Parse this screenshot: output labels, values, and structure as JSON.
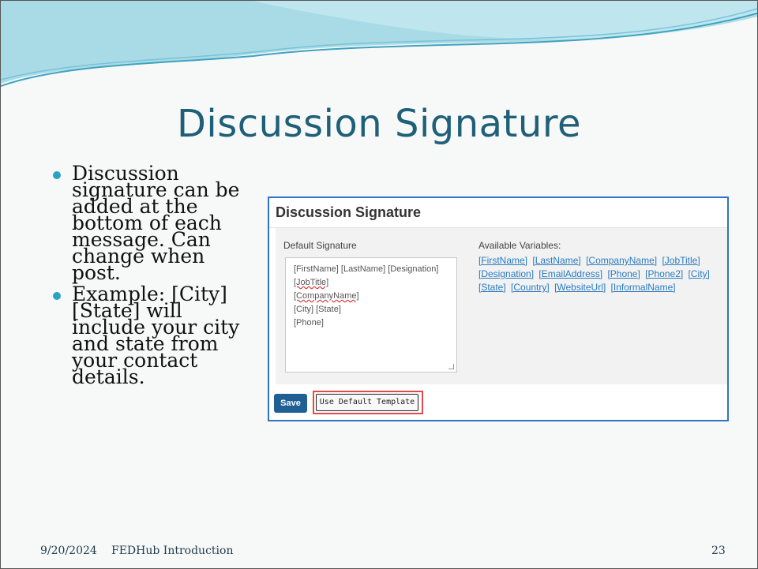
{
  "slide": {
    "title": "Discussion Signature",
    "bullets": [
      "Discussion signature can be added at the bottom of each message.  Can change when post.",
      "Example: [City] [State] will include your city and state from your contact details."
    ],
    "footer": {
      "date": "9/20/2024",
      "title": "FEDHub Introduction",
      "page": "23"
    },
    "colors": {
      "title": "#1f5f78",
      "bullet": "#29a3c3",
      "frame_border": "#2f73c4",
      "highlight": "#e14a4a"
    }
  },
  "screenshot": {
    "heading": "Discussion Signature",
    "default_label": "Default Signature",
    "signature_lines": [
      "[FirstName] [LastName] [Designation]",
      "[JobTitle]",
      "[CompanyName]",
      "[City] [State]",
      "[Phone]"
    ],
    "variables_label": "Available Variables:",
    "variables": [
      "[FirstName]",
      "[LastName]",
      "[CompanyName]",
      "[JobTitle]",
      "[Designation]",
      "[EmailAddress]",
      "[Phone]",
      "[Phone2]",
      "[City]",
      "[State]",
      "[Country]",
      "[WebsiteUrl]",
      "[InformalName]"
    ],
    "save_label": "Save",
    "default_template_label": "Use Default Template"
  }
}
